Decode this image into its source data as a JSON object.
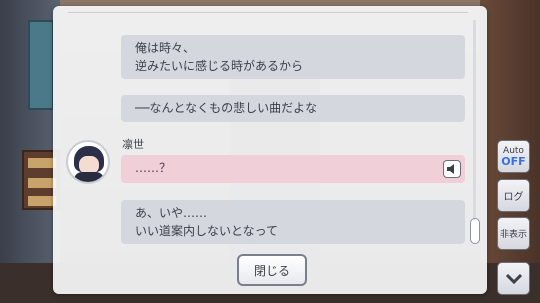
{
  "log": {
    "messages": [
      {
        "lines": [
          "俺は時々、",
          "逆みたいに感じる時があるから"
        ]
      },
      {
        "lines": [
          "──なんとなくもの悲しい曲だよな"
        ]
      },
      {
        "speaker": "凛世",
        "lines": [
          "……？"
        ]
      },
      {
        "lines": [
          "あ、いや……",
          "いい道案内しないとなって"
        ]
      }
    ],
    "close_label": "閉じる"
  },
  "controls": {
    "auto_label": "Auto",
    "auto_state": "OFF",
    "log_label": "ログ",
    "hide_label": "非表示"
  },
  "icons": {
    "voice": "speaker-icon",
    "scroll_down": "chevron-down-icon",
    "avatar": "character-avatar"
  },
  "colors": {
    "panel_bg": "#f6f7f9",
    "bubble": "#d4d8de",
    "bubble_highlight": "#f0cfd9",
    "auto_off": "#3a6fe0"
  }
}
